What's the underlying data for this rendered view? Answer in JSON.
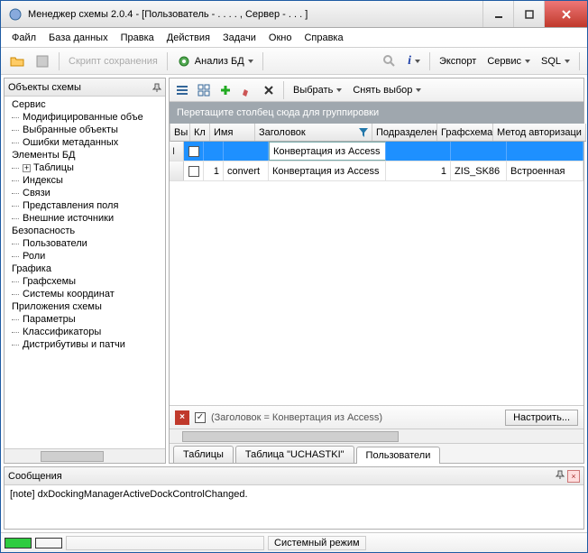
{
  "title": "Менеджер схемы 2.0.4 - [Пользователь -  .  . .  . , Сервер -  .  .  . ]",
  "menu": {
    "file": "Файл",
    "db": "База данных",
    "edit": "Правка",
    "actions": "Действия",
    "tasks": "Задачи",
    "window": "Окно",
    "help": "Справка"
  },
  "toolbar": {
    "script": "Скрипт сохранения",
    "analyze": "Анализ БД",
    "export": "Экспорт",
    "service": "Сервис",
    "sql": "SQL"
  },
  "left": {
    "title": "Объекты схемы",
    "service": "Сервис",
    "service_items": [
      "Модифицированные объе",
      "Выбранные объекты",
      "Ошибки метаданных"
    ],
    "db_elems": "Элементы БД",
    "db_items": [
      "Таблицы",
      "Индексы",
      "Связи",
      "Представления поля",
      "Внешние источники"
    ],
    "security": "Безопасность",
    "security_items": [
      "Пользователи",
      "Роли"
    ],
    "graphics": "Графика",
    "graphics_items": [
      "Графсхемы",
      "Системы координат"
    ],
    "apps": "Приложения схемы",
    "apps_items": [
      "Параметры",
      "Классификаторы",
      "Дистрибутивы и патчи"
    ]
  },
  "grid": {
    "select": "Выбрать",
    "deselect": "Снять выбор",
    "group_hint": "Перетащите столбец сюда для группировки",
    "cols": {
      "chk": "Вы",
      "key": "Кл",
      "name": "Имя",
      "title": "Заголовок",
      "dept": "Подразделен",
      "scheme": "Графсхема",
      "auth": "Метод авторизаци"
    },
    "row_edit": {
      "title": "Конвертация из Access"
    },
    "row1": {
      "key": "1",
      "name": "convert",
      "title": "Конвертация из Access",
      "dept": "1",
      "scheme": "ZIS_SK86",
      "auth": "Встроенная"
    },
    "filter_text": "(Заголовок = Конвертация из Access)",
    "customize": "Настроить..."
  },
  "tabs": {
    "t1": "Таблицы",
    "t2": "Таблица \"UCHASTKI\"",
    "t3": "Пользователи"
  },
  "messages": {
    "title": "Сообщения",
    "body": "[note] dxDockingManagerActiveDockControlChanged."
  },
  "status": {
    "mode": "Системный режим"
  }
}
